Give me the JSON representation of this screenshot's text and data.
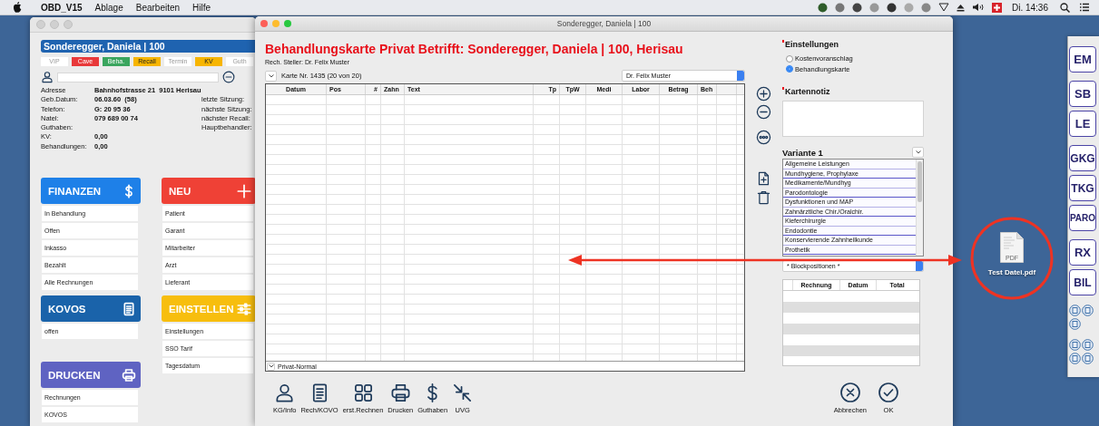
{
  "menu_bar": {
    "app": "OBD_V15",
    "items": [
      "Ablage",
      "Bearbeiten",
      "Hilfe"
    ],
    "clock": "Di. 14:36"
  },
  "patient_window": {
    "patient_name": "Sonderegger, Daniela | 100",
    "tags": [
      {
        "label": "VIP",
        "on": false
      },
      {
        "label": "Cave",
        "on": true,
        "color": "#e8393a"
      },
      {
        "label": "Beha.",
        "on": true,
        "color": "#3aa55e"
      },
      {
        "label": "Recall",
        "on": true,
        "color": "#f7b500"
      },
      {
        "label": "Termin",
        "on": false
      },
      {
        "label": "KV",
        "on": true,
        "color": "#f7b500"
      },
      {
        "label": "Guth",
        "on": false
      }
    ],
    "info": [
      {
        "label": "Adresse",
        "value": "Bahnhofstrasse 21  9101 Herisau"
      },
      {
        "label": "Geb.Datum:",
        "value": "06.03.60  (58)",
        "side_label": "letzte Sitzung:"
      },
      {
        "label": "Telefon:",
        "value": "G: 20 95 36",
        "side_label": "nächste Sitzung:"
      },
      {
        "label": "Natel:",
        "value": "079 689 00 74",
        "side_label": "nächster Recall:"
      },
      {
        "label": "Guthaben:",
        "side_label": "Hauptbehandler:"
      },
      {
        "label": "KV:",
        "value": "0,00"
      },
      {
        "label": "Behandlungen:",
        "value": "0,00"
      }
    ],
    "columns": [
      [
        {
          "title": "FINANZEN",
          "kind": "dollar",
          "color": "#1e80e8",
          "items": [
            "In Behandlung",
            "Offen",
            "Inkasso",
            "Bezahlt",
            "Alle Rechnungen"
          ]
        },
        {
          "title": "KOVOS",
          "kind": "document",
          "color": "#1a63aa",
          "items": [
            "offen"
          ]
        },
        {
          "title": "DRUCKEN",
          "kind": "printer",
          "color": "#5f63c2",
          "items": [
            "Rechnungen",
            "KOVOS"
          ]
        }
      ],
      [
        {
          "title": "NEU",
          "kind": "plus",
          "color": "#ef4136",
          "items": [
            "Patient",
            "Garant",
            "Mitarbeiter",
            "Arzt",
            "Lieferant"
          ]
        },
        {
          "title": "EINSTELLEN",
          "kind": "sliders",
          "color": "#f7be0e",
          "items": [
            "Einstellungen",
            "SSO Tarif",
            "Tagesdatum"
          ]
        }
      ]
    ]
  },
  "treatment_window": {
    "title": "Sonderegger, Daniela | 100",
    "heading": "Behandlungskarte Privat Betrifft: Sonderegger, Daniela | 100, Herisau",
    "biller": "Rech. Steller: Dr. Felix Muster",
    "card_number": "Karte Nr. 1435 (20 von 20)",
    "doctor_select": "Dr. Felix Muster",
    "table": {
      "columns": [
        "Datum",
        "Pos",
        "#",
        "Zahn",
        "Text",
        "Tp",
        "TpW",
        "Medi",
        "Labor",
        "Betrag",
        "Beh"
      ]
    },
    "tariff": "Privat-Normal",
    "settings": {
      "title": "Einstellungen",
      "options": [
        {
          "label": "Kostenvoranschlag",
          "selected": false
        },
        {
          "label": "Behandlungskarte",
          "selected": true
        }
      ]
    },
    "note": {
      "title": "Kartennotiz"
    },
    "variant": {
      "title": "Variante 1",
      "items": [
        "Allgemeine Leistungen",
        "Mundhygiene, Prophylaxe",
        "Medikamente/Mundhyg",
        "Parodontologie",
        "Dysfunktionen und MAP",
        "Zahnärztliche Chir./Oralchir.",
        "Kieferchirurgie",
        "Endodontie",
        "Konservierende Zahnheilkunde",
        "Prothetik"
      ]
    },
    "block_select": "* Blockpositionen *",
    "invoices": {
      "columns": [
        "Rechnung",
        "Datum",
        "Total"
      ]
    },
    "toolbar": [
      {
        "label": "KG/Info",
        "kind": "person"
      },
      {
        "label": "Rech/KOVO",
        "kind": "document"
      },
      {
        "label": "erst.Rechnen",
        "kind": "grid"
      },
      {
        "label": "Drucken",
        "kind": "printer"
      },
      {
        "label": "Guthaben",
        "kind": "dollar"
      },
      {
        "label": "UVG",
        "kind": "arrows_in"
      }
    ],
    "actions": [
      {
        "label": "Abbrechen",
        "kind": "cancel"
      },
      {
        "label": "OK",
        "kind": "ok"
      }
    ]
  },
  "palette": {
    "groups": [
      [
        "EM"
      ],
      [
        "SB",
        "LE"
      ],
      [
        "GKG",
        "TKG",
        "PARO"
      ],
      [
        "RX",
        "BIL"
      ]
    ]
  },
  "desktop_file": {
    "name": "Test Datei.pdf",
    "badge": "PDF"
  }
}
